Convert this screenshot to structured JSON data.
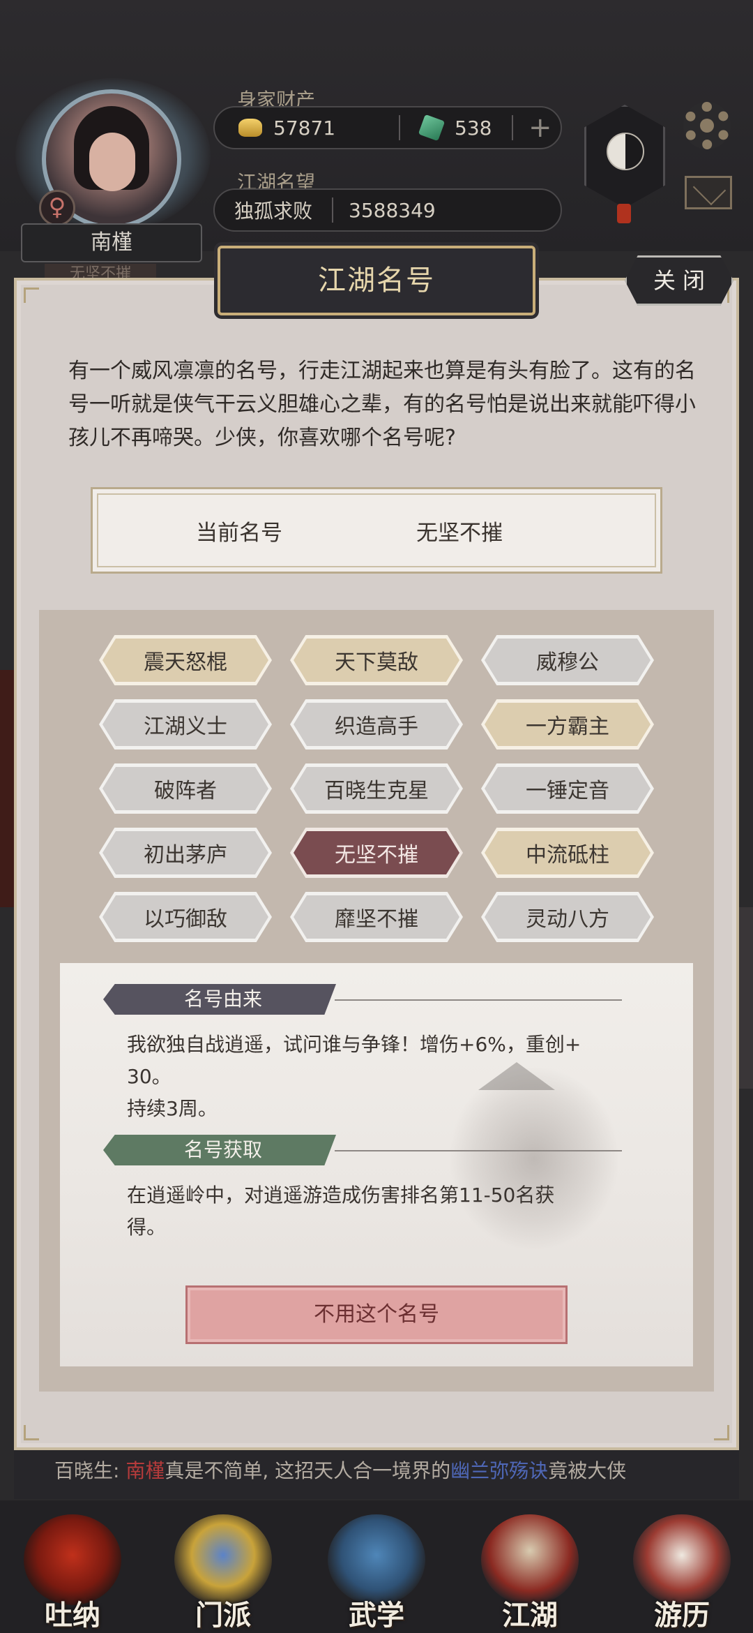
{
  "header": {
    "wealth_label": "身家财产",
    "gold_amount": "57871",
    "jade_amount": "538",
    "add_symbol": "+",
    "reputation_label": "江湖名望",
    "reputation_rank": "独孤求败",
    "reputation_value": "3588349",
    "player_name": "南槿",
    "player_title_behind": "无坚不摧",
    "gender_symbol": "♀"
  },
  "dialog": {
    "title": "江湖名号",
    "close_label": "关闭",
    "intro_text": "有一个威风凛凛的名号，行走江湖起来也算是有头有脸了。这有的名号一听就是侠气干云义胆雄心之辈，有的名号怕是说出来就能吓得小孩儿不再啼哭。少侠，你喜欢哪个名号呢?",
    "current_label": "当前名号",
    "current_value": "无坚不摧",
    "titles": [
      {
        "label": "震天怒棍",
        "style": "gold"
      },
      {
        "label": "天下莫敌",
        "style": "gold"
      },
      {
        "label": "威穆公",
        "style": "gray"
      },
      {
        "label": "江湖义士",
        "style": "gray"
      },
      {
        "label": "织造高手",
        "style": "gray"
      },
      {
        "label": "一方霸主",
        "style": "gold"
      },
      {
        "label": "破阵者",
        "style": "gray"
      },
      {
        "label": "百晓生克星",
        "style": "gray"
      },
      {
        "label": "一锤定音",
        "style": "gray"
      },
      {
        "label": "初出茅庐",
        "style": "gray"
      },
      {
        "label": "无坚不摧",
        "style": "selected"
      },
      {
        "label": "中流砥柱",
        "style": "gold"
      },
      {
        "label": "以巧御敌",
        "style": "gray"
      },
      {
        "label": "靡坚不摧",
        "style": "gray"
      },
      {
        "label": "灵动八方",
        "style": "gray"
      }
    ],
    "origin_heading": "名号由来",
    "origin_line1": "我欲独自战逍遥，试问谁与争锋！增伤+6%，重创+",
    "origin_line2": "30。",
    "origin_line3": "持续3周。",
    "acquire_heading": "名号获取",
    "acquire_line1": "在逍遥岭中，对逍遥游造成伤害排名第11-50名获",
    "acquire_line2": "得。",
    "unequip_label": "不用这个名号"
  },
  "chat": {
    "prefix": "百晓生: ",
    "name": "南槿",
    "middle": "真是不简单, 这招天人合一境界的",
    "skill": "幽兰弥殇诀",
    "suffix": "竟被大侠"
  },
  "nav": [
    {
      "label": "吐纳",
      "icon": "breathing-gourd-icon"
    },
    {
      "label": "门派",
      "icon": "sect-banner-icon"
    },
    {
      "label": "武学",
      "icon": "martial-book-icon"
    },
    {
      "label": "江湖",
      "icon": "jianghu-hat-icon"
    },
    {
      "label": "游历",
      "icon": "travel-horse-icon"
    }
  ],
  "colors": {
    "panel_bg": "#d5ceca",
    "gold_button": "#dccdaf",
    "gray_button": "#cfccca",
    "selected_button": "#7a4c50",
    "origin_tag": "#56535f",
    "acquire_tag": "#5e7a63",
    "unequip_button": "#dfa3a2"
  }
}
